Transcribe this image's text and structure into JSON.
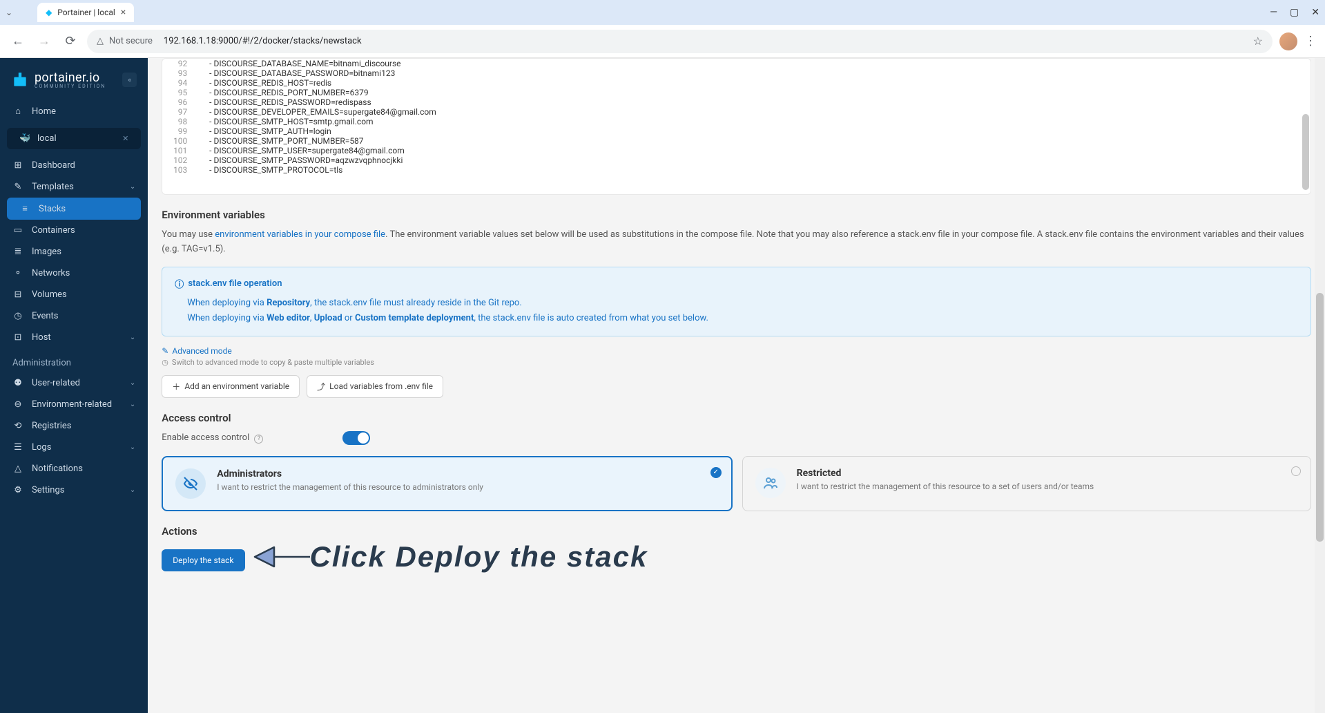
{
  "browser": {
    "tab_title": "Portainer | local",
    "url": "192.168.1.18:9000/#!/2/docker/stacks/newstack",
    "security_label": "Not secure"
  },
  "sidebar": {
    "brand": "portainer.io",
    "brand_sub": "COMMUNITY EDITION",
    "home": "Home",
    "env_name": "local",
    "items": [
      {
        "icon": "⊞",
        "label": "Dashboard"
      },
      {
        "icon": "✎",
        "label": "Templates",
        "chevron": true
      },
      {
        "icon": "≡",
        "label": "Stacks",
        "active": true
      },
      {
        "icon": "▭",
        "label": "Containers"
      },
      {
        "icon": "≣",
        "label": "Images"
      },
      {
        "icon": "⚬",
        "label": "Networks"
      },
      {
        "icon": "⊟",
        "label": "Volumes"
      },
      {
        "icon": "◷",
        "label": "Events"
      },
      {
        "icon": "⊡",
        "label": "Host",
        "chevron": true
      }
    ],
    "admin_label": "Administration",
    "admin_items": [
      {
        "icon": "⚉",
        "label": "User-related",
        "chevron": true
      },
      {
        "icon": "⊖",
        "label": "Environment-related",
        "chevron": true
      },
      {
        "icon": "⟲",
        "label": "Registries"
      },
      {
        "icon": "☰",
        "label": "Logs",
        "chevron": true
      },
      {
        "icon": "△",
        "label": "Notifications"
      },
      {
        "icon": "⚙",
        "label": "Settings",
        "chevron": true
      }
    ]
  },
  "code": {
    "start": 92,
    "lines": [
      "      - DISCOURSE_DATABASE_NAME=bitnami_discourse",
      "      - DISCOURSE_DATABASE_PASSWORD=bitnami123",
      "      - DISCOURSE_REDIS_HOST=redis",
      "      - DISCOURSE_REDIS_PORT_NUMBER=6379",
      "      - DISCOURSE_REDIS_PASSWORD=redispass",
      "      - DISCOURSE_DEVELOPER_EMAILS=supergate84@gmail.com",
      "      - DISCOURSE_SMTP_HOST=smtp.gmail.com",
      "      - DISCOURSE_SMTP_AUTH=login",
      "      - DISCOURSE_SMTP_PORT_NUMBER=587",
      "      - DISCOURSE_SMTP_USER=supergate84@gmail.com",
      "      - DISCOURSE_SMTP_PASSWORD=aqzwzvqphnocjkki",
      "      - DISCOURSE_SMTP_PROTOCOL=tls"
    ]
  },
  "env": {
    "title": "Environment variables",
    "desc_pre": "You may use ",
    "desc_link": "environment variables in your compose file",
    "desc_post": ". The environment variable values set below will be used as substitutions in the compose file. Note that you may also reference a stack.env file in your compose file. A stack.env file contains the environment variables and their values (e.g. TAG=v1.5).",
    "info_title": "stack.env file operation",
    "info_l1a": "When deploying via ",
    "info_l1b": "Repository",
    "info_l1c": ", the stack.env file must already reside in the Git repo.",
    "info_l2a": "When deploying via ",
    "info_l2b": "Web editor",
    "info_l2c": ", ",
    "info_l2d": "Upload",
    "info_l2e": " or ",
    "info_l2f": "Custom template deployment",
    "info_l2g": ", the stack.env file is auto created from what you set below.",
    "adv_link": "Advanced mode",
    "hint": "Switch to advanced mode to copy & paste multiple variables",
    "add_btn": "Add an environment variable",
    "load_btn": "Load variables from .env file"
  },
  "access": {
    "title": "Access control",
    "toggle_label": "Enable access control",
    "opt1_title": "Administrators",
    "opt1_desc": "I want to restrict the management of this resource to administrators only",
    "opt2_title": "Restricted",
    "opt2_desc": "I want to restrict the management of this resource to a set of users and/or teams"
  },
  "actions": {
    "title": "Actions",
    "deploy": "Deploy the stack"
  },
  "annotation": "Click Deploy the stack"
}
